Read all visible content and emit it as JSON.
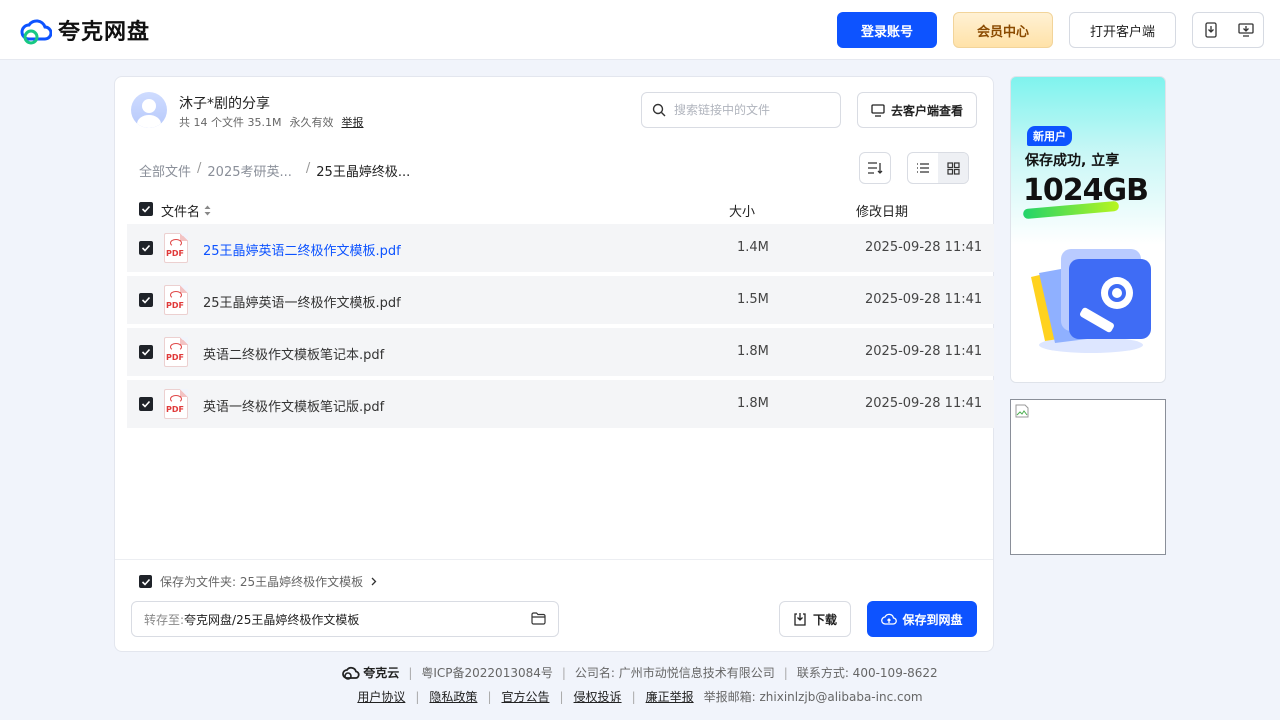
{
  "header": {
    "logo_text": "夸克网盘",
    "login_label": "登录账号",
    "vip_label": "会员中心",
    "client_label": "打开客户端"
  },
  "share": {
    "title": "沐子*剧的分享",
    "file_count": "共 14 个文件 35.1M",
    "validity": "永久有效",
    "report": "举报",
    "search_placeholder": "搜索链接中的文件",
    "view_client_label": "去客户端查看"
  },
  "breadcrumb": {
    "items": [
      "全部文件",
      "2025考研英...",
      "25王晶婷终极..."
    ]
  },
  "columns": {
    "name": "文件名",
    "size": "大小",
    "date": "修改日期"
  },
  "files": [
    {
      "name": "25王晶婷英语二终极作文模板.pdf",
      "size": "1.4M",
      "date": "2025-09-28 11:41",
      "icon": "PDF"
    },
    {
      "name": "25王晶婷英语一终极作文模板.pdf",
      "size": "1.5M",
      "date": "2025-09-28 11:41",
      "icon": "PDF"
    },
    {
      "name": "英语二终极作文模板笔记本.pdf",
      "size": "1.8M",
      "date": "2025-09-28 11:41",
      "icon": "PDF"
    },
    {
      "name": "英语一终极作文模板笔记版.pdf",
      "size": "1.8M",
      "date": "2025-09-28 11:41",
      "icon": "PDF"
    }
  ],
  "bottom": {
    "save_as_folder": "保存为文件夹: 25王晶婷终极作文模板",
    "dest_prefix": "转存至:",
    "dest_path": "夸克网盘/25王晶婷终极作文模板",
    "download_label": "下载",
    "save_label": "保存到网盘"
  },
  "ad": {
    "tag": "新用户",
    "line1": "保存成功, 立享",
    "big": "1024GB"
  },
  "footer": {
    "brand": "夸克云",
    "icp": "粤ICP备2022013084号",
    "company": "公司名: 广州市动悦信息技术有限公司",
    "contact": "联系方式: 400-109-8622",
    "links": [
      "用户协议",
      "隐私政策",
      "官方公告",
      "侵权投诉",
      "廉正举报"
    ],
    "mail": "举报邮箱: zhixinlzjb@alibaba-inc.com"
  },
  "colors": {
    "accent": "#0d53ff",
    "vip": "#ffe2a8",
    "background": "#f1f4fb"
  }
}
